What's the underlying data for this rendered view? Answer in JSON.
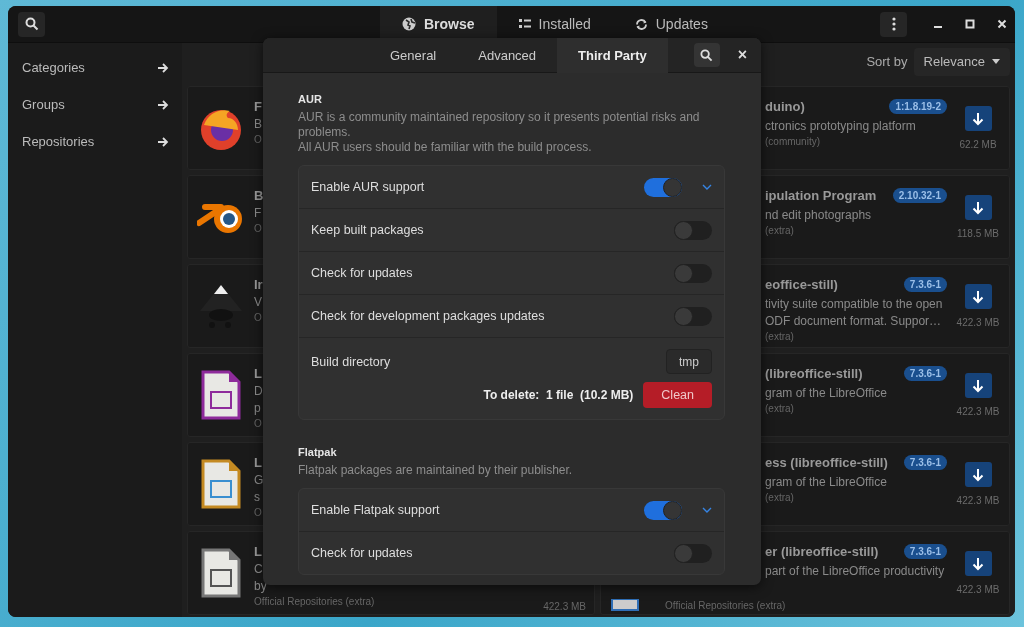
{
  "header": {
    "view_tabs": [
      {
        "label": "Browse",
        "selected": true
      },
      {
        "label": "Installed",
        "selected": false
      },
      {
        "label": "Updates",
        "selected": false
      }
    ]
  },
  "sidebar": {
    "items": [
      {
        "label": "Categories"
      },
      {
        "label": "Groups"
      },
      {
        "label": "Repositories"
      }
    ]
  },
  "sort": {
    "label": "Sort by",
    "value": "Relevance"
  },
  "packages_left": [
    {
      "name": "F",
      "description": [
        "B"
      ],
      "repository": "O"
    },
    {
      "name": "B",
      "description": [
        "F"
      ],
      "repository": "O"
    },
    {
      "name": "Ir",
      "description": [
        "V"
      ],
      "repository": "O"
    },
    {
      "name": "L",
      "description": [
        "D",
        "p"
      ],
      "repository": "O"
    },
    {
      "name": "L",
      "description": [
        "G",
        "s"
      ],
      "repository": "O"
    },
    {
      "name": "L",
      "description": [
        "C",
        "by"
      ],
      "repository": "Official Repositories (extra)",
      "size": "422.3 MB"
    }
  ],
  "packages_right": [
    {
      "name": "duino)",
      "version": "1:1.8.19-2",
      "description": [
        "ctronics prototyping platform"
      ],
      "repository": "(community)",
      "size": "62.2 MB"
    },
    {
      "name": "ipulation Program",
      "version": "2.10.32-1",
      "description": [
        "nd edit photographs"
      ],
      "repository": "(extra)",
      "size": "118.5 MB"
    },
    {
      "name": "eoffice-still)",
      "version": "7.3.6-1",
      "description": [
        "tivity suite compatible to the open",
        "ODF document format. Suppor…"
      ],
      "repository": "(extra)",
      "size": "422.3 MB"
    },
    {
      "name": "(libreoffice-still)",
      "version": "7.3.6-1",
      "description": [
        "gram of the LibreOffice"
      ],
      "repository": "(extra)",
      "size": "422.3 MB"
    },
    {
      "name": "ess (libreoffice-still)",
      "version": "7.3.6-1",
      "description": [
        "gram of the LibreOffice"
      ],
      "repository": "(extra)",
      "size": "422.3 MB"
    },
    {
      "name": "er (libreoffice-still)",
      "version": "7.3.6-1",
      "description": [
        "part of the LibreOffice productivity"
      ],
      "repository": "Official Repositories (extra)",
      "size": "422.3 MB"
    }
  ],
  "dialog": {
    "tabs": [
      {
        "label": "General",
        "selected": false
      },
      {
        "label": "Advanced",
        "selected": false
      },
      {
        "label": "Third Party",
        "selected": true
      }
    ],
    "close": "×",
    "sections": [
      {
        "title": "AUR",
        "description": [
          "AUR is a community maintained repository so it presents potential risks and problems.",
          "All AUR users should be familiar with the build process."
        ],
        "rows": [
          {
            "kind": "toggle",
            "label": "Enable AUR support",
            "on": true,
            "expandable": true
          },
          {
            "kind": "toggle",
            "label": "Keep built packages",
            "on": false,
            "expandable": false
          },
          {
            "kind": "toggle",
            "label": "Check for updates",
            "on": false,
            "expandable": false
          },
          {
            "kind": "toggle",
            "label": "Check for development packages updates",
            "on": false,
            "expandable": false
          },
          {
            "kind": "directory",
            "label": "Build directory",
            "value": "tmp",
            "summary": "To delete:  1 file  (10.2 MB)",
            "action": "Clean"
          }
        ]
      },
      {
        "title": "Flatpak",
        "description": [
          "Flatpak packages are maintained by their publisher."
        ],
        "rows": [
          {
            "kind": "toggle",
            "label": "Enable Flatpak support",
            "on": true,
            "expandable": true
          },
          {
            "kind": "toggle",
            "label": "Check for updates",
            "on": false,
            "expandable": false
          }
        ]
      }
    ]
  }
}
